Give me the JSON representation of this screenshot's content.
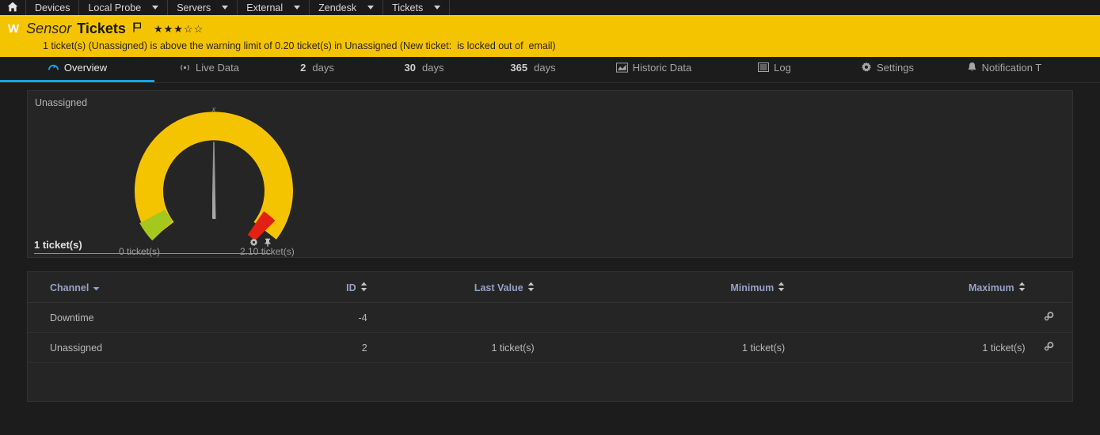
{
  "topnav": {
    "items": [
      {
        "label": "",
        "icon": "home-icon",
        "caret": false
      },
      {
        "label": "Devices",
        "icon": "",
        "caret": false
      },
      {
        "label": "Local Probe",
        "icon": "",
        "caret": true
      },
      {
        "label": "Servers",
        "icon": "",
        "caret": true
      },
      {
        "label": "External",
        "icon": "",
        "caret": true
      },
      {
        "label": "Zendesk",
        "icon": "",
        "caret": true
      },
      {
        "label": "Tickets",
        "icon": "",
        "caret": true
      }
    ]
  },
  "banner": {
    "badge": "W",
    "type_label": "Sensor",
    "name": "Tickets",
    "flag_icon": "flag-icon",
    "priority_stars_filled": 3,
    "priority_stars_total": 5,
    "star_filled_glyph": "★",
    "star_empty_glyph": "☆",
    "message_part1": "1 ticket(s) (Unassigned) is above the warning limit of 0.20 ticket(s) in Unassigned (New ticket:",
    "message_redacted1": "                              ",
    "message_part2": "is locked out of",
    "message_redacted2": "            ",
    "message_part3": "email)",
    "accent_color": "#f5c400"
  },
  "tabs": {
    "accent_color": "#1ba1e2",
    "items": [
      {
        "label": "Overview",
        "icon": "gauge-icon",
        "num": "",
        "active": true
      },
      {
        "label": "Live Data",
        "icon": "live-data-icon",
        "num": "",
        "active": false
      },
      {
        "label": "days",
        "icon": "",
        "num": "2",
        "active": false
      },
      {
        "label": "days",
        "icon": "",
        "num": "30",
        "active": false
      },
      {
        "label": "days",
        "icon": "",
        "num": "365",
        "active": false
      },
      {
        "label": "Historic Data",
        "icon": "chart-icon",
        "num": "",
        "active": false
      },
      {
        "label": "Log",
        "icon": "log-icon",
        "num": "",
        "active": false
      },
      {
        "label": "Settings",
        "icon": "gear-icon",
        "num": "",
        "active": false
      },
      {
        "label": "Notification T",
        "icon": "bell-icon",
        "num": "",
        "active": false
      }
    ]
  },
  "gauge": {
    "channel_label": "Unassigned",
    "scale_min_label": "0 ticket(s)",
    "scale_max_label": "2.10 ticket(s)",
    "value_label": "1 ticket(s)",
    "needle_marker": "x",
    "value": 1,
    "min": 0,
    "max": 2.1,
    "colors": {
      "main": "#f5c400",
      "low": "#a6c81e",
      "high": "#e32112",
      "needle": "#9a9a9a"
    }
  },
  "channels_table": {
    "columns": [
      {
        "label": "Channel",
        "sort": "desc"
      },
      {
        "label": "ID",
        "sort": "both"
      },
      {
        "label": "Last Value",
        "sort": "both"
      },
      {
        "label": "Minimum",
        "sort": "both"
      },
      {
        "label": "Maximum",
        "sort": "both"
      },
      {
        "label": "",
        "sort": "none"
      }
    ],
    "rows": [
      {
        "channel": "Downtime",
        "id": "-4",
        "last_value": "",
        "minimum": "",
        "maximum": "",
        "action_icon": "gears-icon"
      },
      {
        "channel": "Unassigned",
        "id": "2",
        "last_value": "1 ticket(s)",
        "minimum": "1 ticket(s)",
        "maximum": "1 ticket(s)",
        "action_icon": "gears-icon"
      }
    ]
  }
}
